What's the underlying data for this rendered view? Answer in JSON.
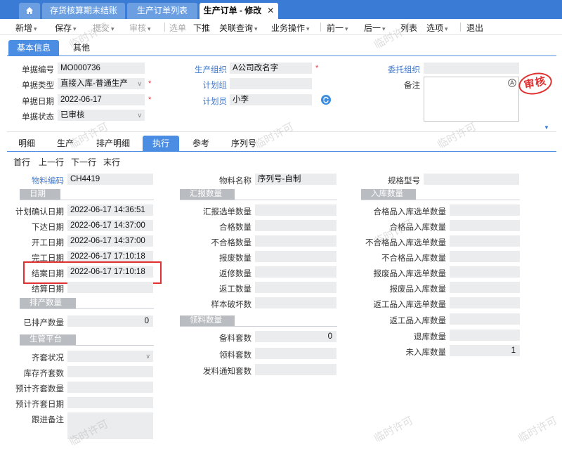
{
  "tabs": [
    {
      "label": ""
    },
    {
      "label": "存货核算期末结账"
    },
    {
      "label": "生产订单列表"
    },
    {
      "label": "生产订单 - 修改"
    }
  ],
  "toolbar": {
    "new": "新增",
    "save": "保存",
    "submit": "提交",
    "audit": "审核",
    "select_doc": "选单",
    "push": "下推",
    "linked_query": "关联查询",
    "biz_op": "业务操作",
    "prev": "前一",
    "next": "后一",
    "list": "列表",
    "options": "选项",
    "exit": "退出"
  },
  "header_tabs": [
    "基本信息",
    "其他"
  ],
  "basic": {
    "doc_no": {
      "label": "单据编号",
      "value": "MO000736"
    },
    "doc_type": {
      "label": "单据类型",
      "value": "直接入库-普通生产"
    },
    "doc_date": {
      "label": "单据日期",
      "value": "2022-06-17"
    },
    "doc_status": {
      "label": "单据状态",
      "value": "已审核"
    },
    "prod_org": {
      "label": "生产组织",
      "value": "A公司改名字"
    },
    "plan_group": {
      "label": "计划组",
      "value": ""
    },
    "planner": {
      "label": "计划员",
      "value": "小李"
    },
    "entrust_org": {
      "label": "委托组织",
      "value": ""
    },
    "remark": {
      "label": "备注",
      "value": ""
    },
    "stamp": "审核"
  },
  "detail_tabs": [
    "明细",
    "生产",
    "排产明细",
    "执行",
    "参考",
    "序列号"
  ],
  "row_nav": [
    "首行",
    "上一行",
    "下一行",
    "末行"
  ],
  "material": {
    "code_label": "物料编码",
    "code": "CH4419",
    "name_label": "物料名称",
    "name": "序列号-自制",
    "spec_label": "规格型号",
    "spec": ""
  },
  "date_section": {
    "title": "日期",
    "rows": [
      {
        "label": "计划确认日期",
        "value": "2022-06-17 14:36:51"
      },
      {
        "label": "下达日期",
        "value": "2022-06-17 14:37:00"
      },
      {
        "label": "开工日期",
        "value": "2022-06-17 14:37:00"
      },
      {
        "label": "完工日期",
        "value": "2022-06-17 17:10:18"
      },
      {
        "label": "结案日期",
        "value": "2022-06-17 17:10:18"
      },
      {
        "label": "结算日期",
        "value": ""
      }
    ]
  },
  "schedule_section": {
    "title": "排产数量",
    "rows": [
      {
        "label": "已排产数量",
        "value": "0"
      }
    ]
  },
  "prod_platform": {
    "title": "生管平台",
    "rows": [
      {
        "label": "齐套状况",
        "value": ""
      },
      {
        "label": "库存齐套数",
        "value": ""
      },
      {
        "label": "预计齐套数量",
        "value": ""
      },
      {
        "label": "预计齐套日期",
        "value": ""
      },
      {
        "label": "跟进备注",
        "value": ""
      }
    ]
  },
  "report_section": {
    "title": "汇报数量",
    "rows": [
      {
        "label": "汇报选单数量",
        "value": ""
      },
      {
        "label": "合格数量",
        "value": ""
      },
      {
        "label": "不合格数量",
        "value": ""
      },
      {
        "label": "报废数量",
        "value": ""
      },
      {
        "label": "返修数量",
        "value": ""
      },
      {
        "label": "返工数量",
        "value": ""
      },
      {
        "label": "样本破坏数",
        "value": ""
      }
    ]
  },
  "issue_section": {
    "title": "领料数量",
    "rows": [
      {
        "label": "备料套数",
        "value": "0"
      },
      {
        "label": "领料套数",
        "value": ""
      },
      {
        "label": "发料通知套数",
        "value": ""
      }
    ]
  },
  "stockin_section": {
    "title": "入库数量",
    "rows": [
      {
        "label": "合格品入库选单数量",
        "value": ""
      },
      {
        "label": "合格品入库数量",
        "value": ""
      },
      {
        "label": "不合格品入库选单数量",
        "value": ""
      },
      {
        "label": "不合格品入库数量",
        "value": ""
      },
      {
        "label": "报废品入库选单数量",
        "value": ""
      },
      {
        "label": "报废品入库数量",
        "value": ""
      },
      {
        "label": "返工品入库选单数量",
        "value": ""
      },
      {
        "label": "返工品入库数量",
        "value": ""
      },
      {
        "label": "退库数量",
        "value": ""
      },
      {
        "label": "未入库数量",
        "value": "1"
      }
    ]
  },
  "watermark": "临时许可",
  "colors": {
    "tabbar": "#3a7bd5",
    "active_tab": "#4a8de3",
    "section": "#b9bcc1",
    "highlight": "#e03030",
    "link": "#3e78cc"
  }
}
